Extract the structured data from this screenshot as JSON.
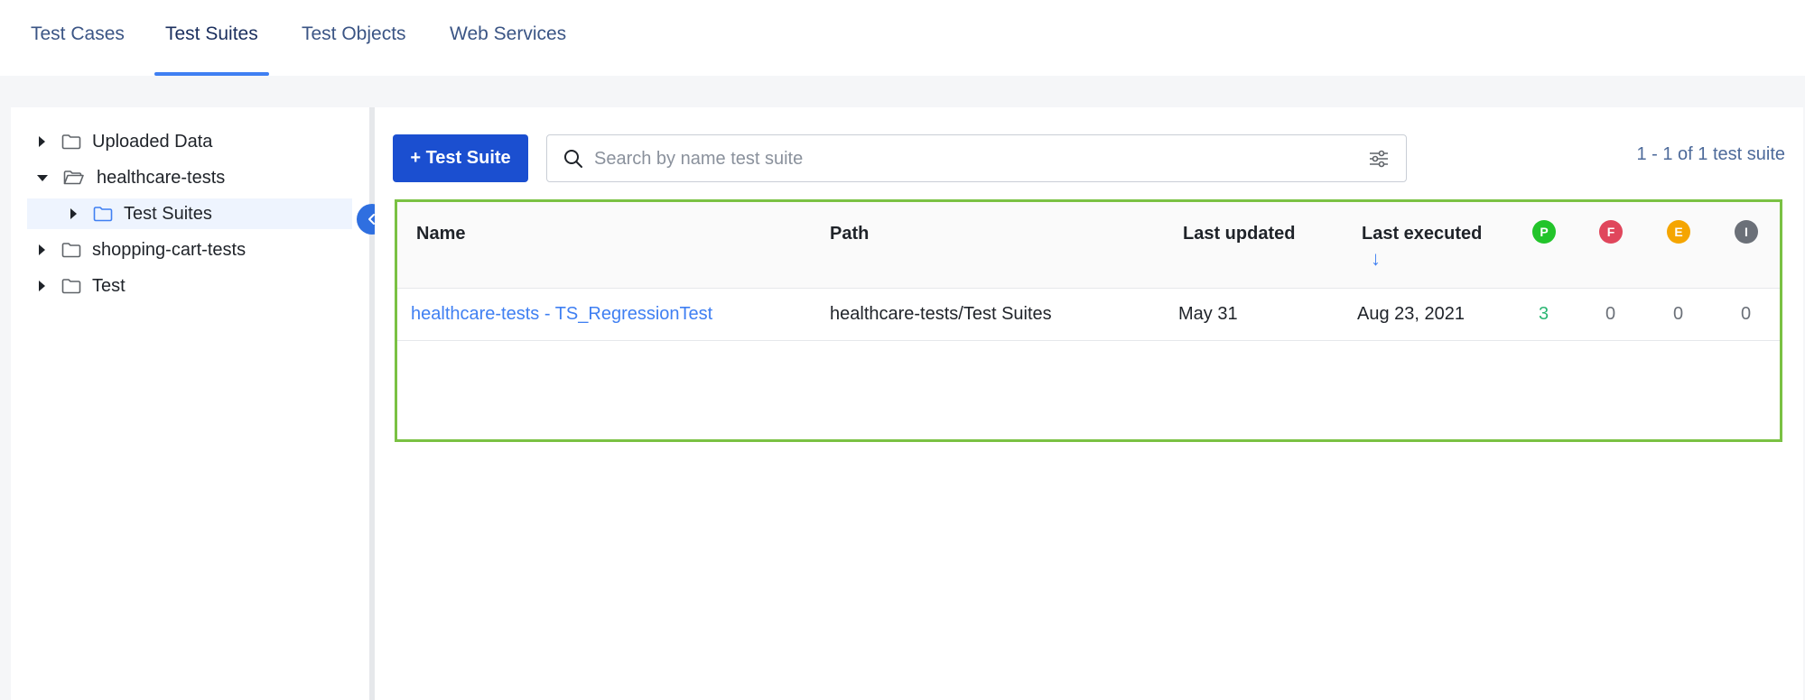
{
  "tabs": [
    {
      "label": "Test Cases",
      "active": false
    },
    {
      "label": "Test Suites",
      "active": true
    },
    {
      "label": "Test Objects",
      "active": false
    },
    {
      "label": "Web Services",
      "active": false
    }
  ],
  "tree": [
    {
      "label": "Uploaded Data",
      "expanded": false,
      "level": 0
    },
    {
      "label": "healthcare-tests",
      "expanded": true,
      "level": 0
    },
    {
      "label": "Test Suites",
      "expanded": false,
      "level": 1,
      "selected": true
    },
    {
      "label": "shopping-cart-tests",
      "expanded": false,
      "level": 0
    },
    {
      "label": "Test",
      "expanded": false,
      "level": 0
    }
  ],
  "toolbar": {
    "add_label": "+ Test Suite",
    "search_placeholder": "Search by name test suite",
    "pager": "1 - 1 of 1 test suite"
  },
  "table": {
    "headers": {
      "name": "Name",
      "path": "Path",
      "last_updated": "Last updated",
      "last_executed": "Last executed",
      "passed": "P",
      "failed": "F",
      "error": "E",
      "incomplete": "I"
    },
    "sort_arrow": "↓",
    "rows": [
      {
        "name": "healthcare-tests - TS_RegressionTest",
        "path": "healthcare-tests/Test Suites",
        "last_updated": "May 31",
        "last_executed": "Aug 23, 2021",
        "passed": "3",
        "failed": "0",
        "error": "0",
        "incomplete": "0"
      }
    ]
  },
  "colors": {
    "accent": "#3f7ff2",
    "primary_button": "#1b4fd0",
    "passed": "#22c42a",
    "failed": "#e0465c",
    "error": "#f5a500",
    "incomplete": "#6b7078",
    "highlight_border": "#7ac143"
  },
  "icons": {
    "search": "search-icon",
    "filter": "filter-sliders-icon",
    "collapse": "chevron-left-icon",
    "folder": "folder-icon",
    "folder_open": "folder-open-icon"
  }
}
